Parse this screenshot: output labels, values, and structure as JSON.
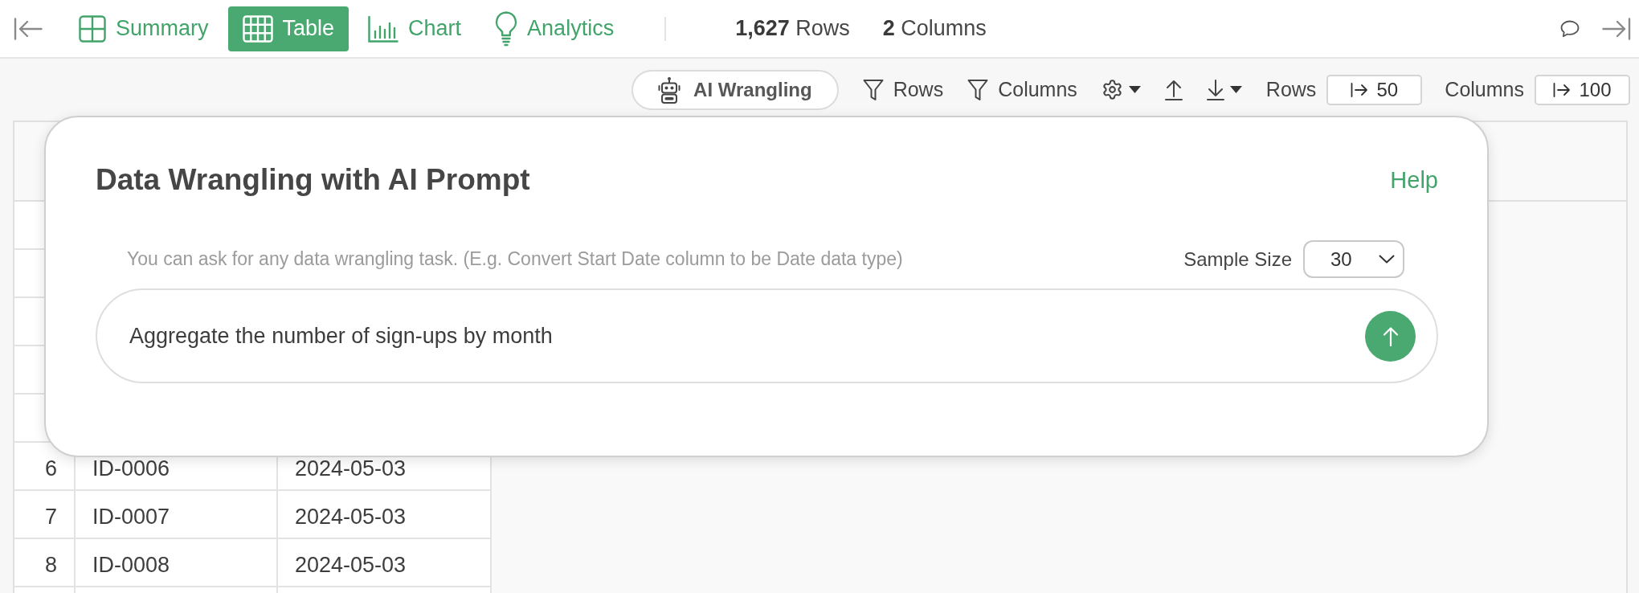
{
  "topbar": {
    "tabs": [
      {
        "label": "Summary",
        "selected": false
      },
      {
        "label": "Table",
        "selected": true
      },
      {
        "label": "Chart",
        "selected": false
      },
      {
        "label": "Analytics",
        "selected": false
      }
    ],
    "stats": [
      "**1,627** Rows",
      "**2** Columns"
    ]
  },
  "toolbar": {
    "ai_button": "AI Wrangling",
    "filters": [
      "Rows",
      "Columns"
    ],
    "limits": [
      {
        "label": "Rows",
        "value": "50"
      },
      {
        "label": "Columns",
        "value": "100"
      }
    ]
  },
  "table": {
    "rows": [
      {
        "number": "6",
        "cells": [
          "ID-0006",
          "2024-05-03"
        ]
      },
      {
        "number": "7",
        "cells": [
          "ID-0007",
          "2024-05-03"
        ]
      },
      {
        "number": "8",
        "cells": [
          "ID-0008",
          "2024-05-03"
        ]
      }
    ]
  },
  "dialog": {
    "title": "Data Wrangling with AI Prompt",
    "help": "Help",
    "hint": "You can ask for any data wrangling task. (E.g. Convert Start Date column to be Date data type)",
    "sample_size": {
      "label": "Sample Size",
      "value": "30"
    },
    "prompt": {
      "value": "Aggregate the number of sign-ups by month"
    }
  }
}
